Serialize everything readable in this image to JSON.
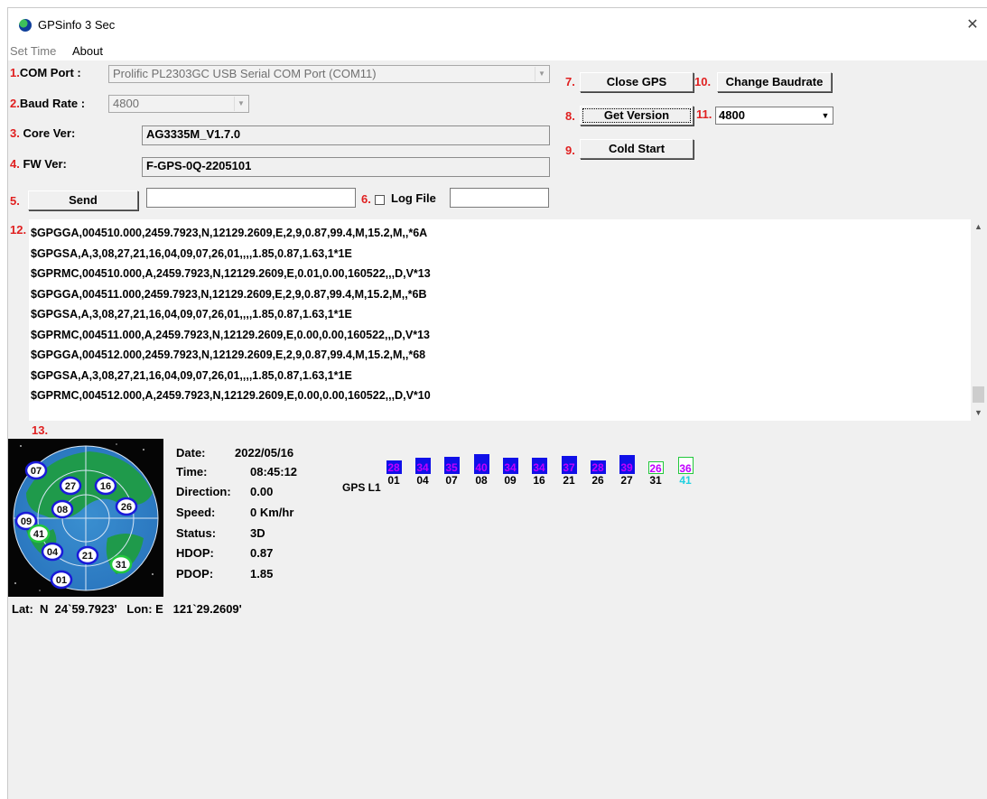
{
  "window": {
    "title": "GPSinfo  3 Sec",
    "close_glyph": "✕",
    "app_icon": "globe-icon"
  },
  "menu": [
    "Set Time",
    "About"
  ],
  "labels": {
    "n1": "1.",
    "com_port": "COM Port :",
    "n2": "2.",
    "baud_rate": "Baud Rate :",
    "n3": "3.",
    "core_ver": "Core Ver:",
    "n4": "4.",
    "fw_ver": "FW Ver:",
    "n5": "5.",
    "n6": "6.",
    "log_file": "Log File",
    "n7": "7.",
    "n8": "8.",
    "n9": "9.",
    "n10": "10.",
    "n11": "11.",
    "n12": "12.",
    "n13": "13."
  },
  "fields": {
    "com_port_value": "Prolific PL2303GC USB Serial COM Port (COM11)",
    "baud_rate_value": "4800",
    "core_ver_value": "AG3335M_V1.7.0",
    "fw_ver_value": "F-GPS-0Q-2205101",
    "send_input": "",
    "log_file_input": "",
    "change_baud_value": "4800"
  },
  "buttons": {
    "send": "Send",
    "close_gps": "Close GPS",
    "get_version": "Get Version",
    "cold_start": "Cold Start",
    "change_baudrate": "Change Baudrate"
  },
  "nmea_log": [
    "$GPGGA,004510.000,2459.7923,N,12129.2609,E,2,9,0.87,99.4,M,15.2,M,,*6A",
    "$GPGSA,A,3,08,27,21,16,04,09,07,26,01,,,,1.85,0.87,1.63,1*1E",
    "$GPRMC,004510.000,A,2459.7923,N,12129.2609,E,0.01,0.00,160522,,,D,V*13",
    "$GPGGA,004511.000,2459.7923,N,12129.2609,E,2,9,0.87,99.4,M,15.2,M,,*6B",
    "$GPGSA,A,3,08,27,21,16,04,09,07,26,01,,,,1.85,0.87,1.63,1*1E",
    "$GPRMC,004511.000,A,2459.7923,N,12129.2609,E,0.00,0.00,160522,,,D,V*13",
    "$GPGGA,004512.000,2459.7923,N,12129.2609,E,2,9,0.87,99.4,M,15.2,M,,*68",
    "$GPGSA,A,3,08,27,21,16,04,09,07,26,01,,,,1.85,0.87,1.63,1*1E",
    "$GPRMC,004512.000,A,2459.7923,N,12129.2609,E,0.00,0.00,160522,,,D,V*10"
  ],
  "status": {
    "date_label": "Date:",
    "date": "2022/05/16",
    "time_label": "Time:",
    "time": "08:45:12",
    "direction_label": "Direction:",
    "direction": "0.00",
    "speed_label": "Speed:",
    "speed": "0 Km/hr",
    "status_label": "Status:",
    "status": "3D",
    "hdop_label": "HDOP:",
    "hdop": "0.87",
    "pdop_label": "PDOP:",
    "pdop": "1.85"
  },
  "sky_sats": [
    {
      "prn": "07",
      "color": "#1a1ad9"
    },
    {
      "prn": "27",
      "color": "#1a1ad9"
    },
    {
      "prn": "16",
      "color": "#1a1ad9"
    },
    {
      "prn": "08",
      "color": "#1a1ad9"
    },
    {
      "prn": "26",
      "color": "#1a1ad9"
    },
    {
      "prn": "09",
      "color": "#1a1ad9"
    },
    {
      "prn": "41",
      "color": "#22c83c"
    },
    {
      "prn": "04",
      "color": "#1a1ad9"
    },
    {
      "prn": "21",
      "color": "#1a1ad9"
    },
    {
      "prn": "31",
      "color": "#22c83c"
    },
    {
      "prn": "01",
      "color": "#1a1ad9"
    }
  ],
  "snr_panel": {
    "band_label": "GPS L1",
    "sats": [
      {
        "prn": "01",
        "snr": "28",
        "used": true
      },
      {
        "prn": "04",
        "snr": "34",
        "used": true
      },
      {
        "prn": "07",
        "snr": "35",
        "used": true
      },
      {
        "prn": "08",
        "snr": "40",
        "used": true
      },
      {
        "prn": "09",
        "snr": "34",
        "used": true
      },
      {
        "prn": "16",
        "snr": "34",
        "used": true
      },
      {
        "prn": "21",
        "snr": "37",
        "used": true
      },
      {
        "prn": "26",
        "snr": "28",
        "used": true
      },
      {
        "prn": "27",
        "snr": "39",
        "used": true
      },
      {
        "prn": "31",
        "snr": "26",
        "used": false
      },
      {
        "prn": "41",
        "snr": "36",
        "used": false
      }
    ],
    "colors": {
      "used_fill": "#1010e8",
      "used_text": "#c000ff",
      "unused_border": "#22c83c",
      "unused_text": "#c000ff",
      "sbas_prn": "#20d0e0"
    }
  },
  "position": {
    "text": "Lat:  N  24`59.7923'   Lon: E   121`29.2609'"
  }
}
